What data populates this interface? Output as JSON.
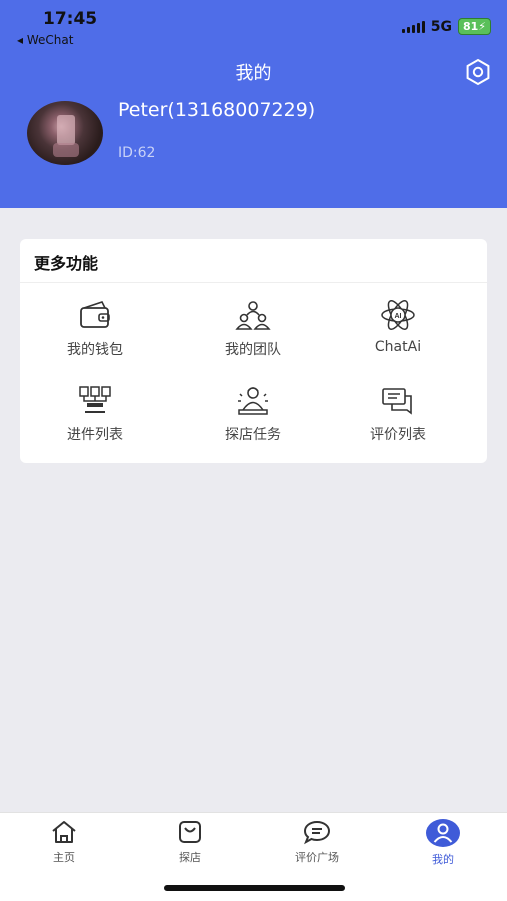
{
  "status_bar": {
    "time": "17:45",
    "back_app": "WeChat",
    "network": "5G",
    "battery": "81"
  },
  "header": {
    "title": "我的"
  },
  "user": {
    "name": "Peter(13168007229)",
    "id_text": "ID:62"
  },
  "functions": {
    "section_title": "更多功能",
    "items": [
      {
        "label": "我的钱包",
        "icon": "wallet-icon"
      },
      {
        "label": "我的团队",
        "icon": "team-icon"
      },
      {
        "label": "ChatAi",
        "icon": "ai-icon"
      },
      {
        "label": "进件列表",
        "icon": "applications-icon"
      },
      {
        "label": "探店任务",
        "icon": "store-task-icon"
      },
      {
        "label": "评价列表",
        "icon": "review-list-icon"
      }
    ]
  },
  "tabbar": {
    "items": [
      {
        "label": "主页",
        "icon": "home-icon",
        "active": false
      },
      {
        "label": "探店",
        "icon": "shop-bag-icon",
        "active": false
      },
      {
        "label": "评价广场",
        "icon": "chat-bubble-icon",
        "active": false
      },
      {
        "label": "我的",
        "icon": "profile-icon",
        "active": true
      }
    ]
  },
  "colors": {
    "brand": "#4f6de8",
    "tab_active": "#3f5bd8",
    "background": "#ebebf0"
  }
}
